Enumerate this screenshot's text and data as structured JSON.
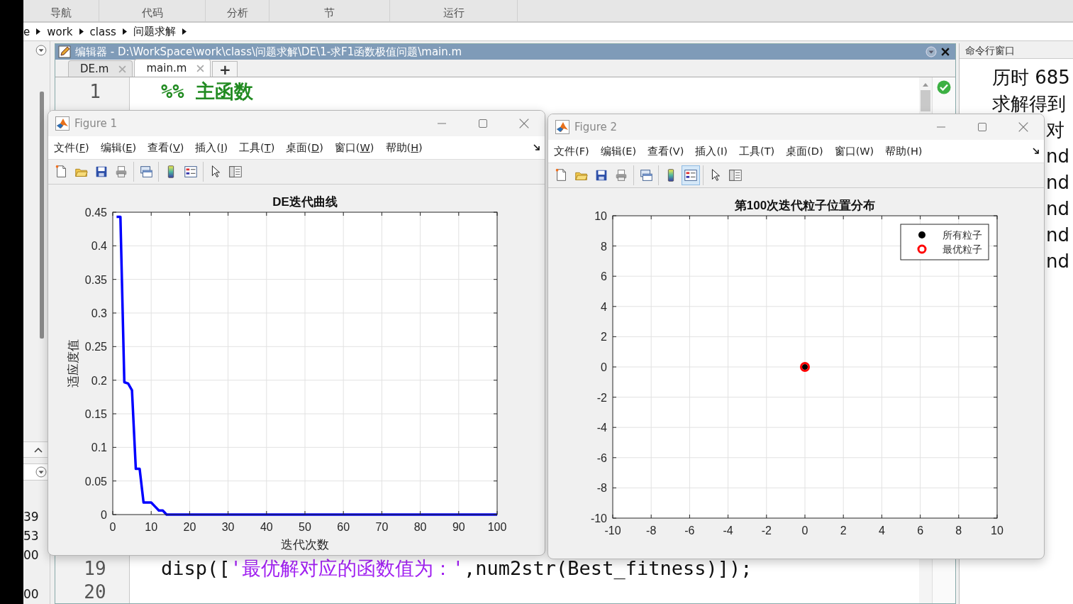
{
  "toolstrip": {
    "sections": [
      "导航",
      "代码",
      "分析",
      "节",
      "运行"
    ]
  },
  "address_bar": {
    "path": [
      "e",
      "work",
      "class",
      "问题求解"
    ]
  },
  "left_panel": {
    "values": [
      "39",
      "53",
      "00",
      "00"
    ]
  },
  "editor": {
    "title": "编辑器 - D:\\WorkSpace\\work\\class\\问题求解\\DE\\1-求F1函数极值问题\\main.m",
    "tabs": [
      {
        "label": "DE.m",
        "selected": false
      },
      {
        "label": "main.m",
        "selected": true
      }
    ],
    "new_tab": "+",
    "lines": [
      {
        "number": "1",
        "parts": [
          {
            "text": "%% 主函数",
            "kind": "comment"
          }
        ]
      },
      {
        "number": "19",
        "parts": [
          {
            "text": "disp([",
            "kind": "plain"
          },
          {
            "text": "'最优解对应的函数值为：'",
            "kind": "string"
          },
          {
            "text": ",num2str(Best_fitness)]);",
            "kind": "plain"
          }
        ]
      },
      {
        "number": "20"
      }
    ]
  },
  "command_window": {
    "title": "命令行窗口",
    "lines": [
      {
        "text": "历时 685",
        "kind": "full"
      },
      {
        "text": "求解得到",
        "kind": "full"
      },
      {
        "text": "对",
        "kind": "covered"
      },
      {
        "text": "nd",
        "kind": "covered"
      },
      {
        "text": "nd",
        "kind": "covered"
      },
      {
        "text": "nd",
        "kind": "covered"
      },
      {
        "text": "nd",
        "kind": "covered"
      },
      {
        "text": "nd",
        "kind": "covered"
      }
    ]
  },
  "figures": [
    {
      "title": "Figure 1",
      "mnemonics_underlined": true,
      "menu": [
        "文件(F)",
        "编辑(E)",
        "查看(V)",
        "插入(I)",
        "工具(T)",
        "桌面(D)",
        "窗口(W)",
        "帮助(H)"
      ],
      "toolbar": [
        {
          "buttons": [
            {
              "kind": "new",
              "selected": false
            },
            {
              "kind": "open",
              "selected": false
            },
            {
              "kind": "save",
              "selected": false
            },
            {
              "kind": "print",
              "selected": false
            }
          ]
        },
        {
          "buttons": [
            {
              "kind": "link",
              "selected": false
            }
          ]
        },
        {
          "buttons": [
            {
              "kind": "colorbar",
              "selected": false
            },
            {
              "kind": "legend",
              "selected": false
            }
          ]
        },
        {
          "buttons": [
            {
              "kind": "pointer",
              "selected": false
            },
            {
              "kind": "inspector",
              "selected": false
            }
          ]
        }
      ],
      "chart_data": {
        "type": "line",
        "title": "DE迭代曲线",
        "xlabel": "迭代次数",
        "ylabel": "适应度值",
        "x": [
          1,
          2,
          3,
          4,
          5,
          6,
          7,
          8,
          9,
          10,
          11,
          12,
          13,
          14,
          15,
          16,
          17,
          18,
          19,
          20,
          21,
          22,
          23,
          24,
          25,
          26,
          27,
          28,
          29,
          30,
          31,
          32,
          33,
          34,
          35,
          36,
          37,
          38,
          39,
          40,
          41,
          42,
          43,
          44,
          45,
          46,
          47,
          48,
          49,
          50,
          51,
          52,
          53,
          54,
          55,
          56,
          57,
          58,
          59,
          60,
          61,
          62,
          63,
          64,
          65,
          66,
          67,
          68,
          69,
          70,
          71,
          72,
          73,
          74,
          75,
          76,
          77,
          78,
          79,
          80,
          81,
          82,
          83,
          84,
          85,
          86,
          87,
          88,
          89,
          90,
          91,
          92,
          93,
          94,
          95,
          96,
          97,
          98,
          99,
          100
        ],
        "series": [
          {
            "color": "#0000ff",
            "values": [
              0.443,
              0.443,
              0.197,
              0.195,
              0.185,
              0.068,
              0.068,
              0.018,
              0.018,
              0.018,
              0.012,
              0.006,
              0.006,
              0,
              0,
              0,
              0,
              0,
              0,
              0,
              0,
              0,
              0,
              0,
              0,
              0,
              0,
              0,
              0,
              0,
              0,
              0,
              0,
              0,
              0,
              0,
              0,
              0,
              0,
              0,
              0,
              0,
              0,
              0,
              0,
              0,
              0,
              0,
              0,
              0,
              0,
              0,
              0,
              0,
              0,
              0,
              0,
              0,
              0,
              0,
              0,
              0,
              0,
              0,
              0,
              0,
              0,
              0,
              0,
              0,
              0,
              0,
              0,
              0,
              0,
              0,
              0,
              0,
              0,
              0,
              0,
              0,
              0,
              0,
              0,
              0,
              0,
              0,
              0,
              0,
              0,
              0,
              0,
              0,
              0,
              0,
              0,
              0,
              0,
              0
            ]
          }
        ],
        "xlim": [
          0,
          100
        ],
        "ylim": [
          0,
          0.45
        ],
        "xticks": [
          {
            "value": 0,
            "label": "0"
          },
          {
            "value": 10,
            "label": "10"
          },
          {
            "value": 20,
            "label": "20"
          },
          {
            "value": 30,
            "label": "30"
          },
          {
            "value": 40,
            "label": "40"
          },
          {
            "value": 50,
            "label": "50"
          },
          {
            "value": 60,
            "label": "60"
          },
          {
            "value": 70,
            "label": "70"
          },
          {
            "value": 80,
            "label": "80"
          },
          {
            "value": 90,
            "label": "90"
          },
          {
            "value": 100,
            "label": "100"
          }
        ],
        "yticks": [
          0,
          0.05,
          0.1,
          0.15,
          0.2,
          0.25,
          0.3,
          0.35,
          0.4,
          0.45
        ],
        "grid": true
      }
    },
    {
      "title": "Figure 2",
      "mnemonics_underlined": false,
      "menu": [
        "文件(F)",
        "编辑(E)",
        "查看(V)",
        "插入(I)",
        "工具(T)",
        "桌面(D)",
        "窗口(W)",
        "帮助(H)"
      ],
      "toolbar": [
        {
          "buttons": [
            {
              "kind": "new",
              "selected": false
            },
            {
              "kind": "open",
              "selected": false
            },
            {
              "kind": "save",
              "selected": false
            },
            {
              "kind": "print",
              "selected": false
            }
          ]
        },
        {
          "buttons": [
            {
              "kind": "link",
              "selected": false
            }
          ]
        },
        {
          "buttons": [
            {
              "kind": "colorbar",
              "selected": false
            },
            {
              "kind": "legend",
              "selected": true
            }
          ]
        },
        {
          "buttons": [
            {
              "kind": "pointer",
              "selected": false
            },
            {
              "kind": "inspector",
              "selected": false
            }
          ]
        }
      ],
      "chart_data": {
        "type": "scatter",
        "title": "第100次迭代粒子位置分布",
        "x": [
          0
        ],
        "series": [
          {
            "name": "所有粒子",
            "color": "#000000",
            "marker": "circle",
            "values": [
              0
            ]
          },
          {
            "name": "最优粒子",
            "color": "#ff0000",
            "marker": "circle",
            "values": [
              0
            ]
          }
        ],
        "legend": true,
        "grid": true,
        "xlim": [
          -10,
          10
        ],
        "ylim": [
          -10,
          10
        ],
        "xticks": [
          -10,
          -8,
          -6,
          -4,
          -2,
          0,
          2,
          4,
          6,
          8,
          10
        ],
        "yticks": [
          -10,
          -8,
          -6,
          -4,
          -2,
          0,
          2,
          4,
          6,
          8,
          10
        ]
      }
    }
  ]
}
